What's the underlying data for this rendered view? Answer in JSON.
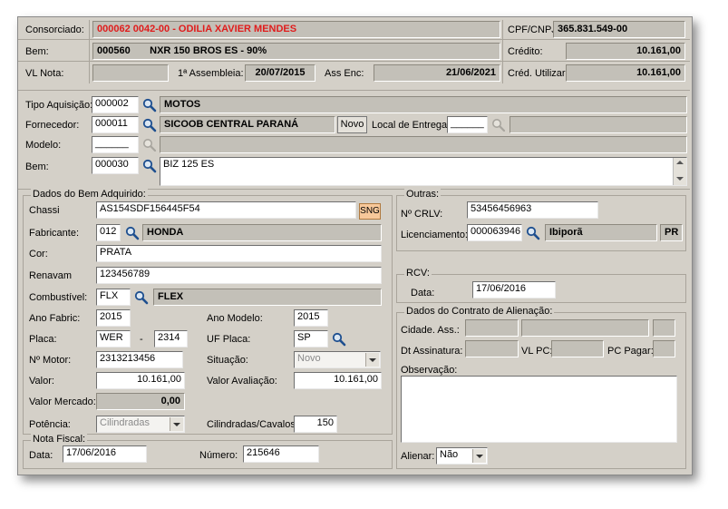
{
  "header": {
    "consorciado_label": "Consorciado:",
    "consorciado_value": "000062 0042-00 - ODILIA XAVIER MENDES",
    "cpf_label": "CPF/CNPJ:",
    "cpf_value": "365.831.549-00",
    "bem_label": "Bem:",
    "bem_code": "000560",
    "bem_desc": "NXR 150 BROS ES - 90%",
    "credito_label": "Crédito:",
    "credito_value": "10.161,00",
    "vlnota_label": "VL Nota:",
    "vlnota_value": "",
    "assembleia_label": "1ª Assembleia:",
    "assembleia_value": "20/07/2015",
    "assenc_label": "Ass Enc:",
    "assenc_value": "21/06/2021",
    "cred_util_label": "Créd. Utilizar:",
    "cred_util_value": "10.161,00"
  },
  "acquisition": {
    "tipo_label": "Tipo Aquisição:",
    "tipo_code": "000002",
    "tipo_desc": "MOTOS",
    "fornecedor_label": "Fornecedor:",
    "fornecedor_code": "000011",
    "fornecedor_desc": "SICOOB CENTRAL PARANÁ",
    "novo_button": "Novo",
    "local_label": "Local de Entrega:",
    "local_value": "______",
    "modelo_label": "Modelo:",
    "modelo_value": "______",
    "bem_label": "Bem:",
    "bem_code": "000030",
    "bem_desc": "BIZ 125 ES"
  },
  "dados_bem": {
    "title": "Dados do Bem Adquirido:",
    "chassi_label": "Chassi",
    "chassi_value": "AS154SDF156445F54",
    "sng_button": "SNG",
    "fabricante_label": "Fabricante:",
    "fabricante_code": "012",
    "fabricante_desc": "HONDA",
    "cor_label": "Cor:",
    "cor_value": "PRATA",
    "renavam_label": "Renavam",
    "renavam_value": "123456789",
    "combustivel_label": "Combustível:",
    "combustivel_code": "FLX",
    "combustivel_desc": "FLEX",
    "ano_fabric_label": "Ano Fabric:",
    "ano_fabric_value": "2015",
    "ano_modelo_label": "Ano Modelo:",
    "ano_modelo_value": "2015",
    "placa_label": "Placa:",
    "placa_letters": "WER",
    "placa_dash": "-",
    "placa_numbers": "2314",
    "uf_placa_label": "UF Placa:",
    "uf_placa_value": "SP",
    "motor_label": "Nº Motor:",
    "motor_value": "2313213456",
    "situacao_label": "Situação:",
    "situacao_value": "Novo",
    "valor_label": "Valor:",
    "valor_value": "10.161,00",
    "valor_aval_label": "Valor Avaliação:",
    "valor_aval_value": "10.161,00",
    "valor_mercado_label": "Valor Mercado:",
    "valor_mercado_value": "0,00",
    "potencia_label": "Potência:",
    "potencia_value": "Cilindradas",
    "cilindradas_label": "Cilindradas/Cavalos:",
    "cilindradas_value": "150"
  },
  "nota_fiscal": {
    "title": "Nota Fiscal:",
    "data_label": "Data:",
    "data_value": "17/06/2016",
    "numero_label": "Número:",
    "numero_value": "215646"
  },
  "outras": {
    "title": "Outras:",
    "crlv_label": "Nº CRLV:",
    "crlv_value": "53456456963",
    "licenciamento_label": "Licenciamento:",
    "licenciamento_code": "000063946",
    "licenciamento_desc": "Ibiporã",
    "licenciamento_uf": "PR"
  },
  "rcv": {
    "title": "RCV:",
    "data_label": "Data:",
    "data_value": "17/06/2016"
  },
  "alienacao": {
    "title": "Dados do Contrato de Alienação:",
    "cidade_label": "Cidade. Ass.:",
    "dt_assinatura_label": "Dt Assinatura:",
    "vl_pc_label": "VL PC:",
    "pc_pagar_label": "PC Pagar:",
    "observacao_label": "Observação:",
    "observacao_value": "",
    "alienar_label": "Alienar:",
    "alienar_value": "Não"
  },
  "icons": {
    "lookup": "magnifier-icon",
    "scroll_up": "scroll-up-arrow-icon",
    "scroll_down": "scroll-down-arrow-icon",
    "combo": "chevron-down-icon"
  },
  "colors": {
    "panel": "#d4d0c8",
    "readonly": "#c3c0b8",
    "highlight_red": "#e01c1c",
    "sng": "#f7c89a"
  }
}
